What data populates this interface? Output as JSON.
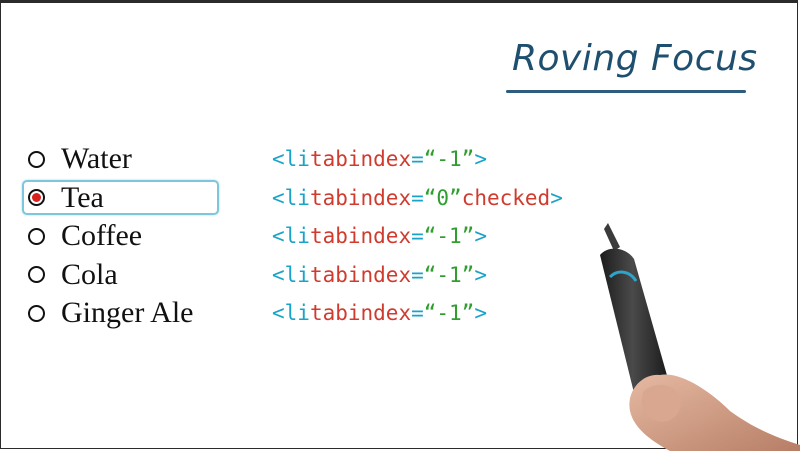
{
  "title": "Roving Focus",
  "radio_options": [
    {
      "label": "Water",
      "checked": false
    },
    {
      "label": "Tea",
      "checked": true
    },
    {
      "label": "Coffee",
      "checked": false
    },
    {
      "label": "Cola",
      "checked": false
    },
    {
      "label": "Ginger Ale",
      "checked": false
    }
  ],
  "code": {
    "open": "<li",
    "attr": "tabindex",
    "eq": "=",
    "close": ">",
    "checked_attr": "checked",
    "lines": [
      {
        "value": "“-1”",
        "checked": false
      },
      {
        "value": "“0”",
        "checked": true
      },
      {
        "value": "“-1”",
        "checked": false
      },
      {
        "value": "“-1”",
        "checked": false
      },
      {
        "value": "“-1”",
        "checked": false
      }
    ]
  },
  "colors": {
    "tag": "#1aa3c8",
    "attribute": "#d03b2e",
    "value": "#2f9e2f",
    "title": "#1f4f6f",
    "focus_ring": "#7dc6dc",
    "radio_checked": "#d9211d"
  }
}
